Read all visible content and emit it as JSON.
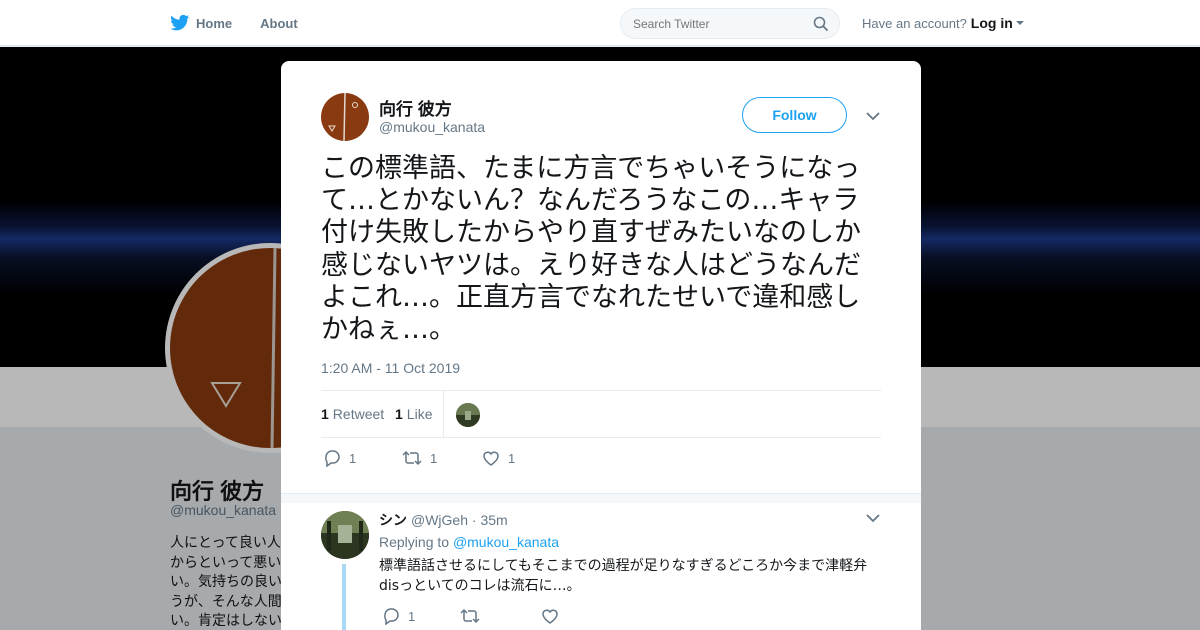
{
  "nav": {
    "home": "Home",
    "about": "About",
    "search_placeholder": "Search Twitter",
    "have_account": "Have an account?",
    "login": "Log in"
  },
  "profile": {
    "name": "向行 彼方",
    "handle": "@mukou_kanata",
    "bio": "人にとって良い人 からといって悪い い。気持ちの良い うが、そんな人間 い。肯定はしない"
  },
  "tweet": {
    "author_name": "向行 彼方",
    "author_handle": "@mukou_kanata",
    "follow_label": "Follow",
    "text": "この標準語、たまに方言でちゃいそうになって…とかないん？なんだろうなこの…キャラ付け失敗したからやり直すぜみたいなのしか感じないヤツは。えり好きな人はどうなんだよこれ…。正直方言でなれたせいで違和感しかねぇ…。",
    "timestamp": "1:20 AM - 11 Oct 2019",
    "retweet_count": "1",
    "retweet_label": "Retweet",
    "like_count": "1",
    "like_label": "Like",
    "reply_action_count": "1",
    "retweet_action_count": "1",
    "like_action_count": "1"
  },
  "reply": {
    "name": "シン",
    "handle": "@WjGeh",
    "time": "· 35m",
    "replying_prefix": "Replying to",
    "replying_to": "@mukou_kanata",
    "text": "標準語話させるにしてもそこまでの過程が足りなすぎるどころか今まで津軽弁disっといてのコレは流石に…。",
    "reply_count": "1"
  },
  "colors": {
    "accent": "#1da1f2",
    "avatar_bg": "#8a3a10"
  }
}
